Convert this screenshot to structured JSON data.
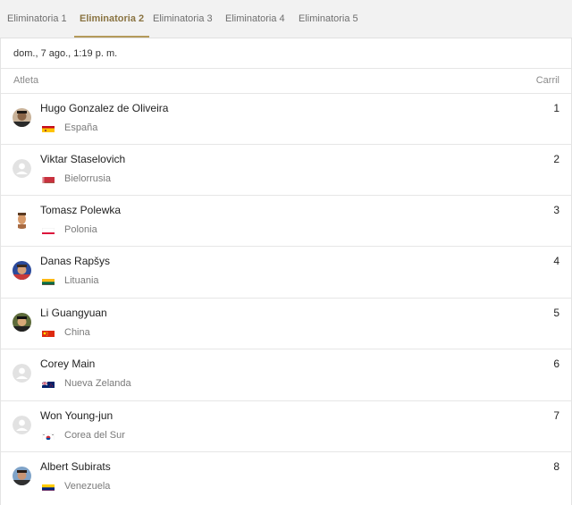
{
  "tabs": [
    {
      "label": "Eliminatoria 1",
      "active": false
    },
    {
      "label": "Eliminatoria 2",
      "active": true
    },
    {
      "label": "Eliminatoria 3",
      "active": false
    },
    {
      "label": "Eliminatoria 4",
      "active": false
    },
    {
      "label": "Eliminatoria 5",
      "active": false
    }
  ],
  "datetime": "dom., 7 ago., 1:19 p. m.",
  "table": {
    "columns": {
      "athlete": "Atleta",
      "lane": "Carril"
    },
    "rows": [
      {
        "name": "Hugo Gonzalez de Oliveira",
        "country": "España",
        "lane": "1",
        "flag": "spain-flag-icon",
        "avatar": "athlete-photo"
      },
      {
        "name": "Viktar Staselovich",
        "country": "Bielorrusia",
        "lane": "2",
        "flag": "belarus-flag-icon",
        "avatar": "placeholder-avatar-icon"
      },
      {
        "name": "Tomasz Polewka",
        "country": "Polonia",
        "lane": "3",
        "flag": "poland-flag-icon",
        "avatar": "athlete-photo"
      },
      {
        "name": "Danas Rapšys",
        "country": "Lituania",
        "lane": "4",
        "flag": "lithuania-flag-icon",
        "avatar": "athlete-photo"
      },
      {
        "name": "Li Guangyuan",
        "country": "China",
        "lane": "5",
        "flag": "china-flag-icon",
        "avatar": "athlete-photo"
      },
      {
        "name": "Corey Main",
        "country": "Nueva Zelanda",
        "lane": "6",
        "flag": "new-zealand-flag-icon",
        "avatar": "placeholder-avatar-icon"
      },
      {
        "name": "Won Young-jun",
        "country": "Corea del Sur",
        "lane": "7",
        "flag": "south-korea-flag-icon",
        "avatar": "placeholder-avatar-icon"
      },
      {
        "name": "Albert Subirats",
        "country": "Venezuela",
        "lane": "8",
        "flag": "venezuela-flag-icon",
        "avatar": "athlete-photo"
      }
    ]
  },
  "colors": {
    "accent": "#b49a5a",
    "active_tab_text": "#8a7442",
    "tab_bar_bg": "#f2f2f2"
  }
}
